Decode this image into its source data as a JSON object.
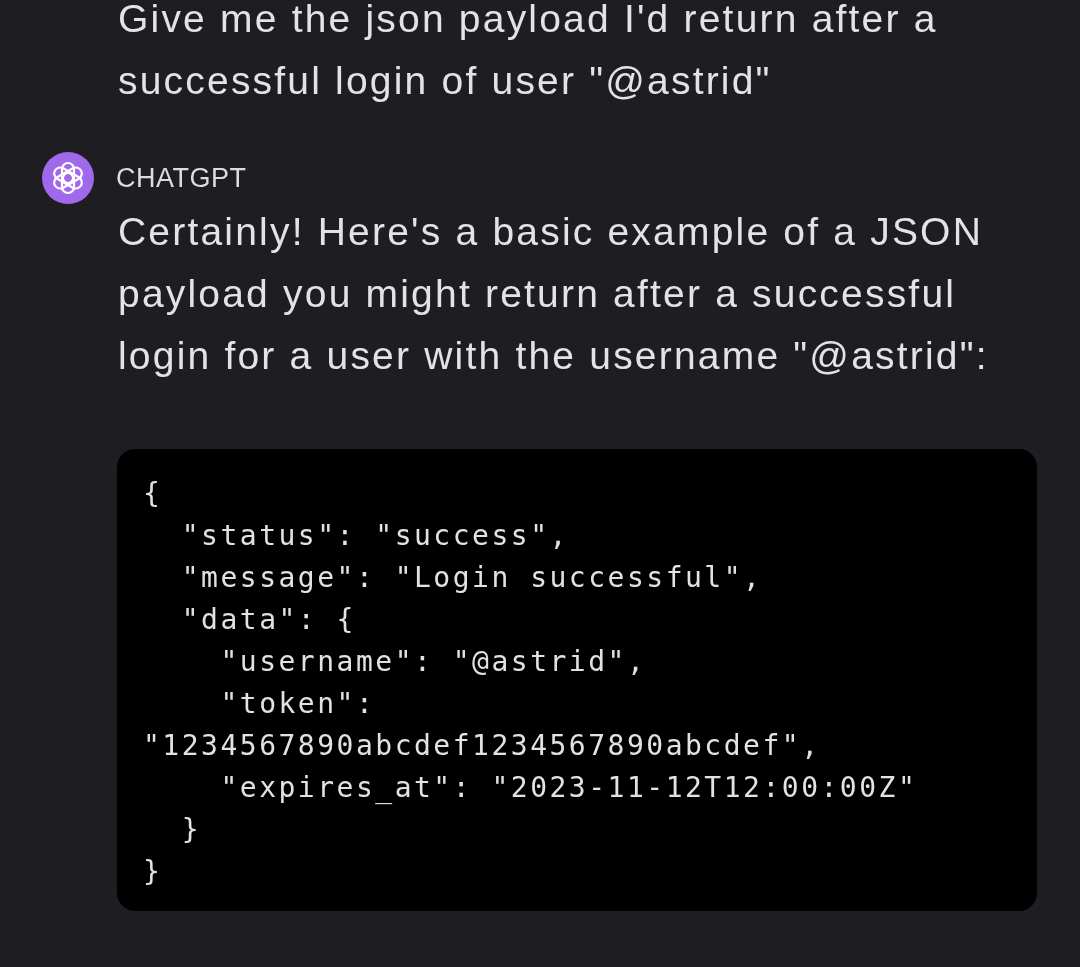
{
  "user_message": {
    "text": "Give me the json payload I'd return after a successful login of user \"@astrid\""
  },
  "assistant_message": {
    "author": "CHATGPT",
    "text": "Certainly! Here's a basic example of a JSON payload you might return after a successful login for a user with the username \"@astrid\":",
    "code_block": {
      "lines": [
        "{",
        "  \"status\": \"success\",",
        "  \"message\": \"Login successful\",",
        "  \"data\": {",
        "    \"username\": \"@astrid\",",
        "    \"token\":",
        "\"1234567890abcdef1234567890abcdef\",",
        "    \"expires_at\": \"2023-11-12T12:00:00Z\"",
        "  }",
        "}"
      ]
    }
  }
}
